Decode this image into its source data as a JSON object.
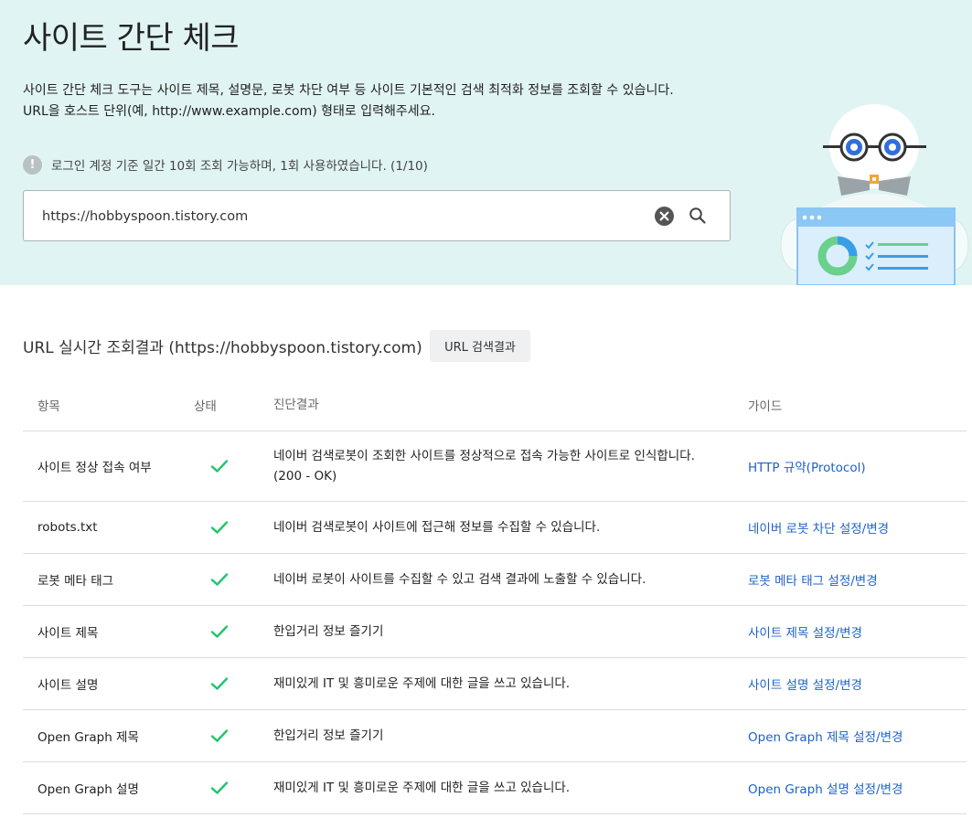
{
  "page": {
    "title": "사이트 간단 체크",
    "desc_line1": "사이트 간단 체크 도구는 사이트 제목, 설명문, 로봇 차단 여부 등 사이트 기본적인 검색 최적화 정보를 조회할 수 있습니다.",
    "desc_line2": "URL을 호스트 단위(예, http://www.example.com) 형태로 입력해주세요.",
    "notice": "로그인 계정 기준 일간 10회 조회 가능하며, 1회 사용하였습니다. (1/10)"
  },
  "search": {
    "value": "https://hobbyspoon.tistory.com"
  },
  "result": {
    "title": "URL 실시간 조회결과 (https://hobbyspoon.tistory.com)",
    "button_label": "URL 검색결과"
  },
  "table": {
    "headers": [
      "항목",
      "상태",
      "진단결과",
      "가이드"
    ],
    "rows": [
      {
        "item": "사이트 정상 접속 여부",
        "status": "ok",
        "result_line1": "네이버 검색로봇이 조회한 사이트를 정상적으로 접속 가능한 사이트로 인식합니다.",
        "result_line2": "(200 - OK)",
        "guide": "HTTP 규약(Protocol)"
      },
      {
        "item": "robots.txt",
        "status": "ok",
        "result_line1": "네이버 검색로봇이 사이트에 접근해 정보를 수집할 수 있습니다.",
        "result_line2": "",
        "guide": "네이버 로봇 차단 설정/변경"
      },
      {
        "item": "로봇 메타 태그",
        "status": "ok",
        "result_line1": "네이버 로봇이 사이트를 수집할 수 있고 검색 결과에 노출할 수 있습니다.",
        "result_line2": "",
        "guide": "로봇 메타 태그 설정/변경"
      },
      {
        "item": "사이트 제목",
        "status": "ok",
        "result_line1": "한입거리 정보 즐기기",
        "result_line2": "",
        "guide": "사이트 제목 설정/변경"
      },
      {
        "item": "사이트 설명",
        "status": "ok",
        "result_line1": "재미있게 IT 및 흥미로운 주제에 대한 글을 쓰고 있습니다.",
        "result_line2": "",
        "guide": "사이트 설명 설정/변경"
      },
      {
        "item": "Open Graph 제목",
        "status": "ok",
        "result_line1": "한입거리 정보 즐기기",
        "result_line2": "",
        "guide": "Open Graph 제목 설정/변경"
      },
      {
        "item": "Open Graph 설명",
        "status": "ok",
        "result_line1": "재미있게 IT 및 흥미로운 주제에 대한 글을 쓰고 있습니다.",
        "result_line2": "",
        "guide": "Open Graph 설명 설정/변경"
      }
    ]
  },
  "colors": {
    "hero_bg": "#e0f4f3",
    "check_green": "#1fc56b",
    "link_blue": "#1e61c8"
  },
  "icons": {
    "notice": "exclamation-icon",
    "clear": "clear-icon",
    "search": "search-icon",
    "status": "check-icon"
  }
}
